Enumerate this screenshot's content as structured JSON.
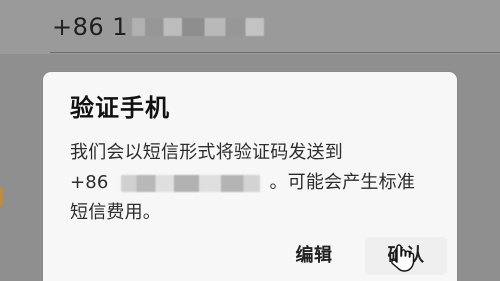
{
  "phone_field": {
    "prefix": "+86 1",
    "mask_icon": "redacted-phone-blur"
  },
  "dialog": {
    "title": "验证手机",
    "message_line_1": "我们会以短信形式将验证码发送到",
    "message_line_2_prefix": "+86",
    "message_line_2_suffix": "。可能会产生标准",
    "message_line_3": "短信费用。",
    "edit_label": "编辑",
    "confirm_label": "确认"
  },
  "icons": {
    "cursor": "hand-cursor-icon",
    "redaction": "blur-redaction-icon"
  },
  "colors": {
    "background_dim": "#8f8f8f",
    "dialog_background": "#f7f7f7",
    "text_primary": "#111111",
    "text_secondary": "#2d2d2d",
    "left_accent": "#ca8b2a"
  }
}
